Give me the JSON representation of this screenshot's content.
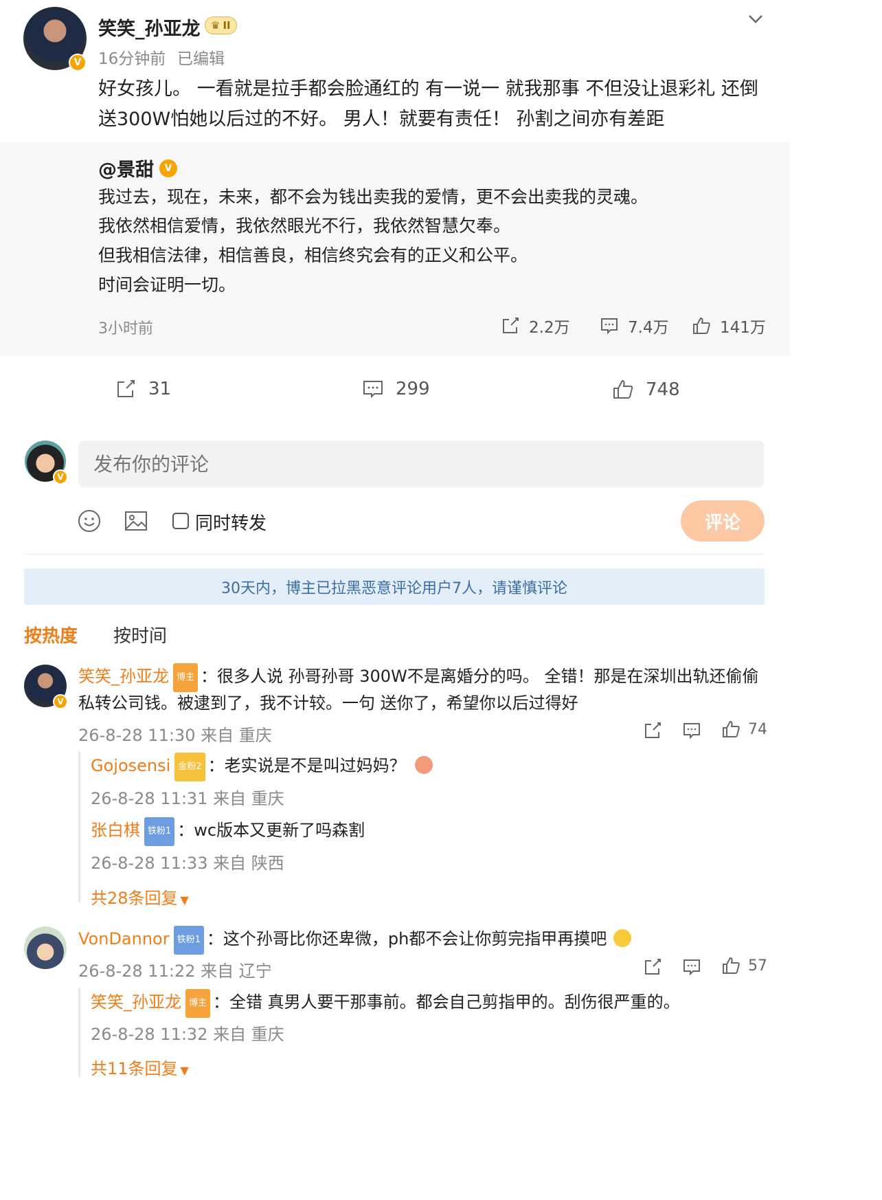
{
  "post": {
    "author": "笑笑_孙亚龙",
    "level_badge": "II",
    "time": "16分钟前",
    "edited": "已编辑",
    "text_line1": "好女孩儿。 一看就是拉手都会脸通红的  有一说一 就我那事 不但没让退彩礼 还倒",
    "text_line2": "送300W怕她以后过的不好。  男人！就要有责任！  孙割之间亦有差距"
  },
  "quoted": {
    "author": "@景甜",
    "lines": [
      "我过去，现在，未来，都不会为钱出卖我的爱情，更不会出卖我的灵魂。",
      "我依然相信爱情，我依然眼光不行，我依然智慧欠奉。",
      "但我相信法律，相信善良，相信终究会有的正义和公平。",
      "时间会证明一切。"
    ],
    "time": "3小时前",
    "repost": "2.2万",
    "comment": "7.4万",
    "like": "141万"
  },
  "actions": {
    "repost": "31",
    "comment": "299",
    "like": "748"
  },
  "compose": {
    "placeholder": "发布你的评论",
    "also_repost": "同时转发",
    "submit": "评论"
  },
  "notice": "30天内，博主已拉黑恶意评论用户7人，请谨慎评论",
  "sort": {
    "hot": "按热度",
    "time": "按时间"
  },
  "comments": [
    {
      "name": "笑笑_孙亚龙",
      "tag": "博主",
      "text_line1": "：很多人说 孙哥孙哥 300W不是离婚分的吗。  全错！那是在深圳出轨还偷偷",
      "text_line2": "私转公司钱。被逮到了，我不计较。一句 送你了，希望你以后过得好",
      "meta": "26-8-28 11:30 来自 重庆",
      "likes": "74",
      "replies": [
        {
          "name": "Gojosensi",
          "tag": "金粉2",
          "text": "：老实说是不是叫过妈妈？",
          "meta": "26-8-28 11:31 来自 重庆"
        },
        {
          "name": "张白棋",
          "tag": "铁粉1",
          "text": "：wc版本又更新了吗森割",
          "meta": "26-8-28 11:33 来自 陕西"
        }
      ],
      "more": "共28条回复"
    },
    {
      "name": "VonDannor",
      "tag": "铁粉1",
      "text_line1": "：这个孙哥比你还卑微，ph都不会让你剪完指甲再摸吧",
      "meta": "26-8-28 11:22 来自 辽宁",
      "likes": "57",
      "replies": [
        {
          "name": "笑笑_孙亚龙",
          "tag": "博主",
          "text": "：全错 真男人要干那事前。都会自己剪指甲的。刮伤很严重的。",
          "meta": "26-8-28 11:32 来自 重庆"
        }
      ],
      "more": "共11条回复"
    }
  ]
}
